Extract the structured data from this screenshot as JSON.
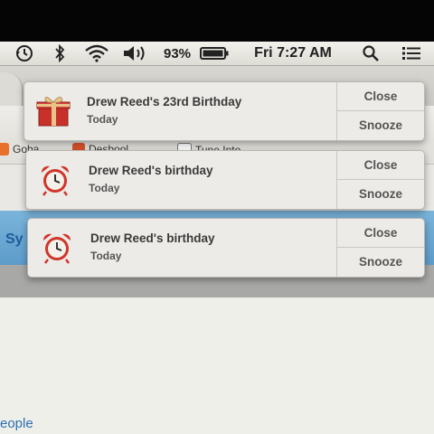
{
  "menubar": {
    "battery_percent": "93%",
    "clock": "Fri 7:27 AM",
    "icons": [
      "time-machine-icon",
      "bluetooth-icon",
      "wifi-icon",
      "volume-icon",
      "battery-icon",
      "spotlight-search-icon",
      "notification-center-icon"
    ]
  },
  "browser": {
    "bookmarks": [
      {
        "label": "Goba",
        "icon": "blogger-icon",
        "color": "#e8702a"
      },
      {
        "label": "Desbool",
        "icon": "bookmark-icon",
        "color": "#d9532b"
      },
      {
        "label": "Tune Into",
        "icon": "page-icon",
        "color": "#ffffff"
      }
    ],
    "banner_text": "Sy",
    "footer_link": "eople"
  },
  "notifications": [
    {
      "icon": "gift-icon",
      "title": "Drew Reed's 23rd Birthday",
      "subtitle": "Today",
      "close_label": "Close",
      "snooze_label": "Snooze"
    },
    {
      "icon": "alarm-clock-icon",
      "title": "Drew Reed's birthday",
      "subtitle": "Today",
      "close_label": "Close",
      "snooze_label": "Snooze"
    },
    {
      "icon": "alarm-clock-icon",
      "title": "Drew Reed's birthday",
      "subtitle": "Today",
      "close_label": "Close",
      "snooze_label": "Snooze"
    }
  ],
  "colors": {
    "alarm_red": "#d0352a",
    "gift_red": "#c8302a",
    "gift_ribbon": "#e9c38a"
  }
}
